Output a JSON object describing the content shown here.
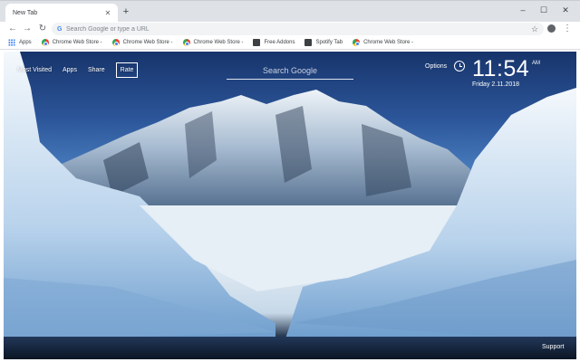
{
  "browser": {
    "tab": {
      "title": "New Tab"
    },
    "omnibox": {
      "placeholder": "Search Google or type a URL"
    },
    "bookmarks": [
      {
        "label": "Apps",
        "icon": "apps-grid-icon"
      },
      {
        "label": "Chrome Web Store -",
        "icon": "chrome-web-store-icon"
      },
      {
        "label": "Chrome Web Store -",
        "icon": "chrome-web-store-icon"
      },
      {
        "label": "Chrome Web Store -",
        "icon": "chrome-web-store-icon"
      },
      {
        "label": "Free Addons",
        "icon": "film-icon"
      },
      {
        "label": "Spotify Tab",
        "icon": "film-icon"
      },
      {
        "label": "Chrome Web Store -",
        "icon": "chrome-web-store-icon"
      }
    ]
  },
  "newtab": {
    "nav": {
      "most_visited": "Most Visited",
      "apps": "Apps",
      "share": "Share",
      "rate": "Rate"
    },
    "search": {
      "placeholder": "Search Google"
    },
    "options": "Options",
    "clock": {
      "time": "11:54",
      "ampm": "AM",
      "date": "Friday  2.11.2018"
    },
    "support": "Support"
  }
}
